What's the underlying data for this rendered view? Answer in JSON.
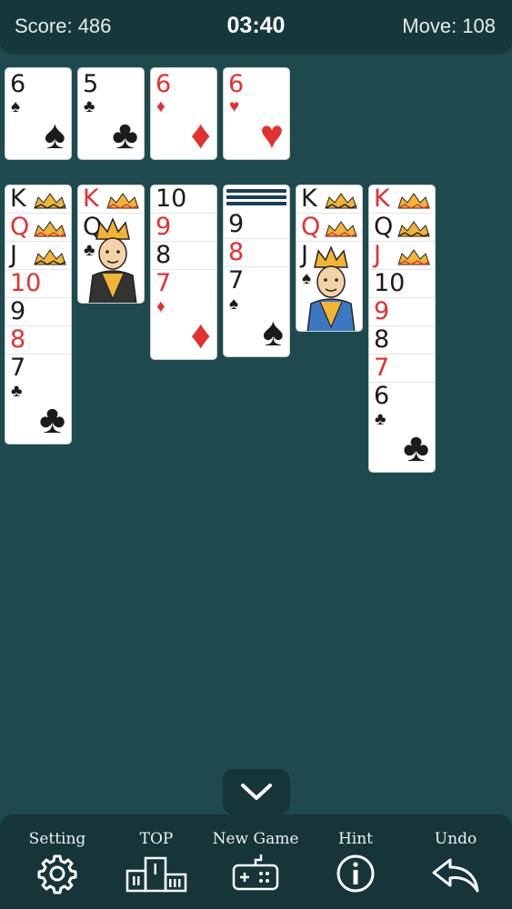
{
  "header": {
    "score": "Score: 486",
    "timer": "03:40",
    "moves": "Move: 108"
  },
  "foundations": [
    {
      "rank": "6",
      "suit": "♠",
      "color": "black"
    },
    {
      "rank": "5",
      "suit": "♣",
      "color": "black"
    },
    {
      "rank": "6",
      "suit": "♦",
      "color": "red"
    },
    {
      "rank": "6",
      "suit": "♥",
      "color": "red"
    }
  ],
  "tableau": [
    {
      "cards": [
        {
          "rank": "K",
          "color": "black",
          "face": true
        },
        {
          "rank": "Q",
          "color": "red",
          "face": true
        },
        {
          "rank": "J",
          "color": "black",
          "face": true
        },
        {
          "rank": "10",
          "color": "red"
        },
        {
          "rank": "9",
          "color": "black"
        },
        {
          "rank": "8",
          "color": "red"
        },
        {
          "rank": "7",
          "suit": "♣",
          "color": "black"
        }
      ]
    },
    {
      "cards": [
        {
          "rank": "K",
          "color": "red",
          "face": true
        },
        {
          "rank": "Q",
          "suit": "♣",
          "color": "black",
          "face": true
        }
      ]
    },
    {
      "cards": [
        {
          "rank": "10",
          "color": "black"
        },
        {
          "rank": "9",
          "color": "red"
        },
        {
          "rank": "8",
          "color": "black"
        },
        {
          "rank": "7",
          "suit": "♦",
          "color": "red"
        }
      ]
    },
    {
      "hidden": 1,
      "cards": [
        {
          "rank": "9",
          "color": "black"
        },
        {
          "rank": "8",
          "color": "red"
        },
        {
          "rank": "7",
          "suit": "♠",
          "color": "black"
        }
      ]
    },
    {
      "cards": [
        {
          "rank": "K",
          "color": "black",
          "face": true
        },
        {
          "rank": "Q",
          "color": "red",
          "face": true
        },
        {
          "rank": "J",
          "suit": "♠",
          "color": "black",
          "face": true
        }
      ]
    },
    {
      "cards": [
        {
          "rank": "K",
          "color": "red",
          "face": true
        },
        {
          "rank": "Q",
          "color": "black",
          "face": true
        },
        {
          "rank": "J",
          "color": "red",
          "face": true
        },
        {
          "rank": "10",
          "color": "black"
        },
        {
          "rank": "9",
          "color": "red"
        },
        {
          "rank": "8",
          "color": "black"
        },
        {
          "rank": "7",
          "color": "red"
        },
        {
          "rank": "6",
          "suit": "♣",
          "color": "black"
        }
      ]
    }
  ],
  "toolbar": {
    "setting": "Setting",
    "top": "TOP",
    "new_game": "New Game",
    "hint": "Hint",
    "undo": "Undo"
  },
  "colors": {
    "table": "#1e4a4d",
    "bar": "#163538",
    "red": "#e33131",
    "black": "#1b1b1b"
  }
}
